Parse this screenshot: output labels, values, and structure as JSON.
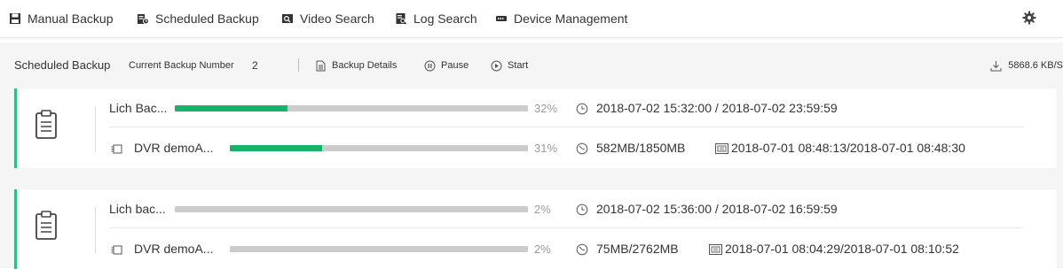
{
  "nav": {
    "items": [
      {
        "label": "Manual Backup",
        "icon": "floppy-disk-icon"
      },
      {
        "label": "Scheduled Backup",
        "icon": "scheduled-backup-icon"
      },
      {
        "label": "Video Search",
        "icon": "video-search-icon"
      },
      {
        "label": "Log Search",
        "icon": "log-search-icon"
      },
      {
        "label": "Device Management",
        "icon": "device-icon"
      }
    ],
    "settings_icon": "gear-icon"
  },
  "subheader": {
    "title": "Scheduled Backup",
    "count_label": "Current Backup Number",
    "count": "2",
    "actions": {
      "details": "Backup Details",
      "pause": "Pause",
      "start": "Start"
    },
    "speed": "5868.6 KB/S"
  },
  "tasks": [
    {
      "name": "Lich Bac...",
      "task_progress": 32,
      "task_progress_label": "32%",
      "time_range": "2018-07-02 15:32:00 / 2018-07-02 23:59:59",
      "device": "DVR demoA...",
      "device_progress": 31,
      "device_progress_label": "31%",
      "size": "582MB/1850MB",
      "record_range": "2018-07-01 08:48:13/2018-07-01 08:48:30"
    },
    {
      "name": "Lich bac...",
      "task_progress": 2,
      "task_progress_label": "2%",
      "time_range": "2018-07-02 15:36:00 / 2018-07-02 16:59:59",
      "device": "DVR demoA...",
      "device_progress": 2,
      "device_progress_label": "2%",
      "size": "75MB/2762MB",
      "record_range": "2018-07-01 08:04:29/2018-07-01 08:10:52"
    }
  ],
  "colors": {
    "accent": "#17b36a",
    "card_border": "#2cbf7f",
    "bar_track": "#cccccc"
  }
}
